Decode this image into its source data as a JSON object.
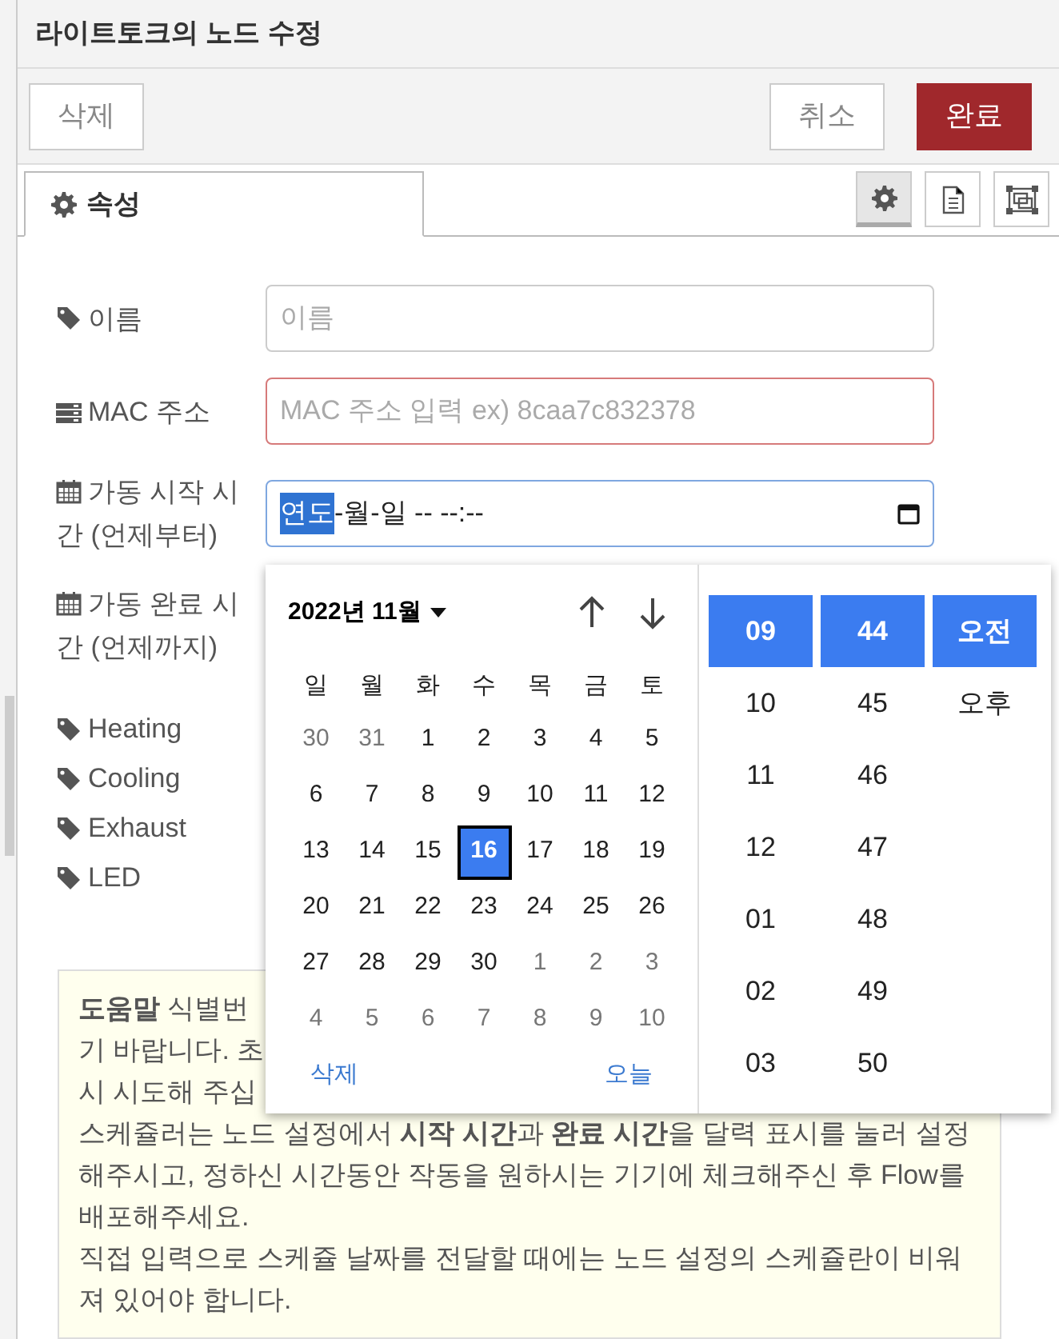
{
  "dialog": {
    "title": "라이트토크의 노드 수정",
    "left_buttons": [
      {
        "label": "삭제",
        "kind": "default"
      }
    ],
    "right_buttons": [
      {
        "label": "취소",
        "kind": "default"
      },
      {
        "label": "완료",
        "kind": "primary"
      }
    ],
    "tabs": [
      {
        "label": "속성",
        "selected": true
      }
    ],
    "tool_buttons": [
      {
        "kind": "gear",
        "selected": true
      },
      {
        "kind": "document",
        "selected": false
      },
      {
        "kind": "frame",
        "selected": false
      }
    ]
  },
  "form": {
    "fields": [
      {
        "kind": "text",
        "label": "이름",
        "placeholder": "이름",
        "invalid": false
      },
      {
        "kind": "mac",
        "label": "MAC 주소",
        "placeholder": "MAC 주소 입력 ex) 8caa7c832378",
        "invalid": true
      },
      {
        "kind": "datetime",
        "label": "가동 시작 시간 (언제부터)",
        "segments": [
          {
            "text": "연도",
            "selected": true
          },
          {
            "text": "-월-일 -- --:--",
            "selected": false
          }
        ]
      },
      {
        "kind": "datetime_covered",
        "label": "가동 완료 시간 (언제까지)"
      }
    ],
    "devices": [
      "Heating",
      "Cooling",
      "Exhaust",
      "LED"
    ]
  },
  "help": {
    "covered_lines": [
      "**도움말** 식별번",
      "기 바랍니다. 초",
      "시 시도해 주십"
    ],
    "paragraphs": [
      "스케쥴러는 노드 설정에서 **시작 시간**과 **완료 시간**을 달력 표시를 눌러 설정해주시고, 정하신 시간동안 작동을 원하시는 기기에 체크해주신 후 Flow를 배포해주세요.",
      "직접 입력으로 스케쥴 날짜를 전달할 때에는 노드 설정의 스케쥴란이 비워져 있어야 합니다."
    ]
  },
  "picker": {
    "month_label": "2022년 11월",
    "weekdays": [
      "일",
      "월",
      "화",
      "수",
      "목",
      "금",
      "토"
    ],
    "weeks": [
      [
        {
          "day": "30",
          "muted": true,
          "selected": false
        },
        {
          "day": "31",
          "muted": true,
          "selected": false
        },
        {
          "day": "1",
          "muted": false,
          "selected": false
        },
        {
          "day": "2",
          "muted": false,
          "selected": false
        },
        {
          "day": "3",
          "muted": false,
          "selected": false
        },
        {
          "day": "4",
          "muted": false,
          "selected": false
        },
        {
          "day": "5",
          "muted": false,
          "selected": false
        }
      ],
      [
        {
          "day": "6",
          "muted": false,
          "selected": false
        },
        {
          "day": "7",
          "muted": false,
          "selected": false
        },
        {
          "day": "8",
          "muted": false,
          "selected": false
        },
        {
          "day": "9",
          "muted": false,
          "selected": false
        },
        {
          "day": "10",
          "muted": false,
          "selected": false
        },
        {
          "day": "11",
          "muted": false,
          "selected": false
        },
        {
          "day": "12",
          "muted": false,
          "selected": false
        }
      ],
      [
        {
          "day": "13",
          "muted": false,
          "selected": false
        },
        {
          "day": "14",
          "muted": false,
          "selected": false
        },
        {
          "day": "15",
          "muted": false,
          "selected": false
        },
        {
          "day": "16",
          "muted": false,
          "selected": true
        },
        {
          "day": "17",
          "muted": false,
          "selected": false
        },
        {
          "day": "18",
          "muted": false,
          "selected": false
        },
        {
          "day": "19",
          "muted": false,
          "selected": false
        }
      ],
      [
        {
          "day": "20",
          "muted": false,
          "selected": false
        },
        {
          "day": "21",
          "muted": false,
          "selected": false
        },
        {
          "day": "22",
          "muted": false,
          "selected": false
        },
        {
          "day": "23",
          "muted": false,
          "selected": false
        },
        {
          "day": "24",
          "muted": false,
          "selected": false
        },
        {
          "day": "25",
          "muted": false,
          "selected": false
        },
        {
          "day": "26",
          "muted": false,
          "selected": false
        }
      ],
      [
        {
          "day": "27",
          "muted": false,
          "selected": false
        },
        {
          "day": "28",
          "muted": false,
          "selected": false
        },
        {
          "day": "29",
          "muted": false,
          "selected": false
        },
        {
          "day": "30",
          "muted": false,
          "selected": false
        },
        {
          "day": "1",
          "muted": true,
          "selected": false
        },
        {
          "day": "2",
          "muted": true,
          "selected": false
        },
        {
          "day": "3",
          "muted": true,
          "selected": false
        }
      ],
      [
        {
          "day": "4",
          "muted": true,
          "selected": false
        },
        {
          "day": "5",
          "muted": true,
          "selected": false
        },
        {
          "day": "6",
          "muted": true,
          "selected": false
        },
        {
          "day": "7",
          "muted": true,
          "selected": false
        },
        {
          "day": "8",
          "muted": true,
          "selected": false
        },
        {
          "day": "9",
          "muted": true,
          "selected": false
        },
        {
          "day": "10",
          "muted": true,
          "selected": false
        }
      ]
    ],
    "footer": [
      "삭제",
      "오늘"
    ],
    "time_columns": [
      [
        {
          "label": "09",
          "selected": true
        },
        {
          "label": "10",
          "selected": false
        },
        {
          "label": "11",
          "selected": false
        },
        {
          "label": "12",
          "selected": false
        },
        {
          "label": "01",
          "selected": false
        },
        {
          "label": "02",
          "selected": false
        },
        {
          "label": "03",
          "selected": false
        }
      ],
      [
        {
          "label": "44",
          "selected": true
        },
        {
          "label": "45",
          "selected": false
        },
        {
          "label": "46",
          "selected": false
        },
        {
          "label": "47",
          "selected": false
        },
        {
          "label": "48",
          "selected": false
        },
        {
          "label": "49",
          "selected": false
        },
        {
          "label": "50",
          "selected": false
        }
      ],
      [
        {
          "label": "오전",
          "selected": true
        },
        {
          "label": "오후",
          "selected": false
        }
      ]
    ]
  }
}
